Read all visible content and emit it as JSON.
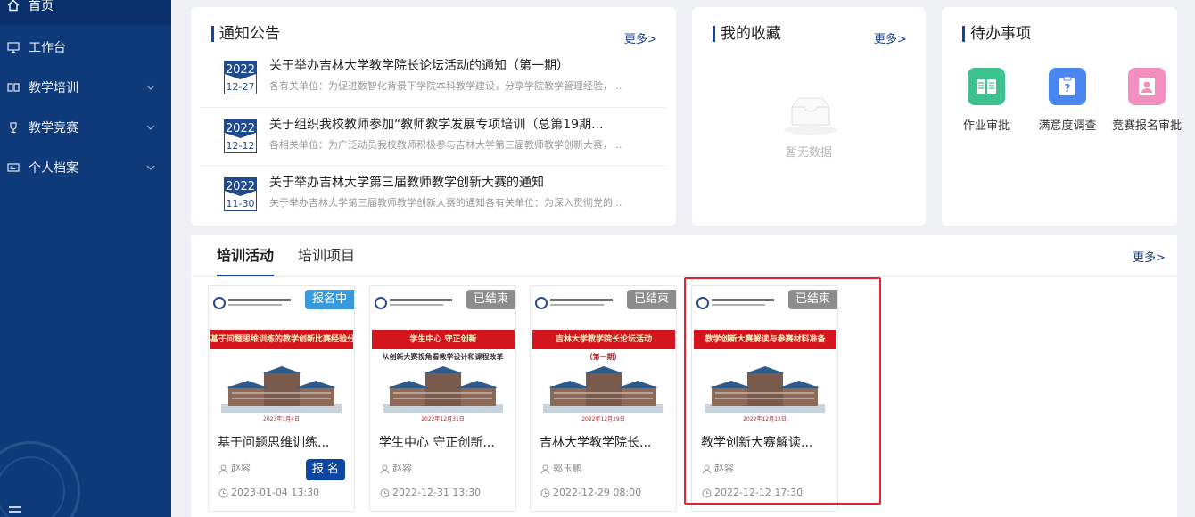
{
  "sidebar": {
    "items": [
      {
        "label": "首页",
        "icon": "home-icon"
      },
      {
        "label": "工作台",
        "icon": "monitor-icon"
      },
      {
        "label": "教学培训",
        "icon": "book-icon"
      },
      {
        "label": "教学竞赛",
        "icon": "trophy-icon"
      },
      {
        "label": "个人档案",
        "icon": "id-card-icon"
      }
    ]
  },
  "notice": {
    "title": "通知公告",
    "more": "更多>",
    "items": [
      {
        "year": "2022",
        "date": "12-27",
        "title": "关于举办吉林大学教学院长论坛活动的通知（第一期）",
        "desc": "各有关单位：为促进数智化背景下学院本科教学建设，分享学院教学管理经验，..."
      },
      {
        "year": "2022",
        "date": "12-12",
        "title": "关于组织我校教师参加“教师教学发展专项培训（总第19期...",
        "desc": "各相关单位：为广泛动员我校教师积极参与吉林大学第三届教师教学创新大赛，..."
      },
      {
        "year": "2022",
        "date": "11-30",
        "title": "关于举办吉林大学第三届教师教学创新大赛的通知",
        "desc": "关于举办吉林大学第三届教师教学创新大赛的通知各有关单位：为深入贯彻党的..."
      }
    ]
  },
  "favorites": {
    "title": "我的收藏",
    "more": "更多>",
    "empty": "暂无数据"
  },
  "todo": {
    "title": "待办事项",
    "items": [
      {
        "label": "作业审批",
        "icon": "homework-icon",
        "color": "#3dc28f"
      },
      {
        "label": "满意度调查",
        "icon": "survey-icon",
        "color": "#4a86f0"
      },
      {
        "label": "竞赛报名审批",
        "icon": "contest-signup-icon",
        "color": "#f38fbf"
      }
    ]
  },
  "training": {
    "tabs": [
      "培训活动",
      "培训项目"
    ],
    "more": "更多>",
    "courses": [
      {
        "status": "报名中",
        "status_color": "#3a9ad9",
        "title": "基于问题思维训练的教学创新比赛经验分享",
        "display_title": "基于问题思维训练...",
        "author": "赵容",
        "time": "2023-01-04 13:30",
        "signup": "报 名",
        "banner": "基于问题思维训练的教学创新比赛经验分享",
        "sub": "",
        "poster_date": "2023年1月4日"
      },
      {
        "status": "已结束",
        "status_color": "#8c8c8c",
        "title": "学生中心 守正创新...",
        "author": "赵容",
        "time": "2022-12-31 13:30",
        "banner": "学生中心 守正创新",
        "sub": "从创新大赛视角看教学设计和课程改革",
        "poster_date": "2022年12月31日"
      },
      {
        "status": "已结束",
        "status_color": "#8c8c8c",
        "title": "吉林大学教学院长...",
        "author": "郭玉鹏",
        "time": "2022-12-29 08:00",
        "banner": "吉林大学教学院长论坛活动",
        "sub": "（第一期）",
        "poster_date": "2022年12月29日"
      },
      {
        "status": "已结束",
        "status_color": "#8c8c8c",
        "title": "教学创新大赛解读...",
        "author": "赵容",
        "time": "2022-12-12 17:30",
        "banner": "教学创新大赛解读与参赛材料准备",
        "sub": "",
        "poster_date": "2022年12月12日"
      }
    ]
  }
}
